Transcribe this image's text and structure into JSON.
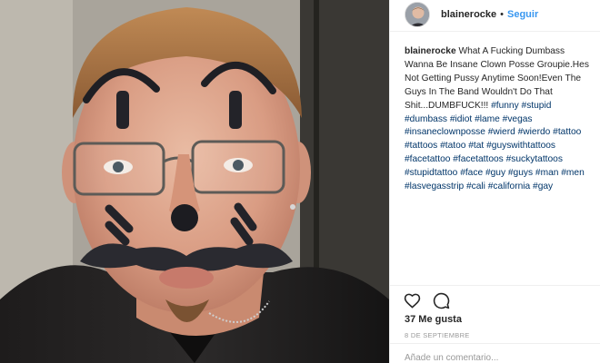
{
  "post": {
    "username": "blainerocke",
    "separator": "•",
    "follow_label": "Seguir",
    "caption_text": "What A Fucking Dumbass Wanna Be Insane Clown Posse Groupie.Hes Not Getting Pussy Anytime Soon!Even The Guys In The Band Wouldn't Do That Shit...DUMBFUCK!!!",
    "hashtags": [
      "#funny",
      "#stupid",
      "#dumbass",
      "#idiot",
      "#lame",
      "#vegas",
      "#insaneclownposse",
      "#wierd",
      "#wierdo",
      "#tattoo",
      "#tattoos",
      "#tatoo",
      "#tat",
      "#guyswithtattoos",
      "#facetattoo",
      "#facetattoos",
      "#suckytattoos",
      "#stupidtattoo",
      "#face",
      "#guy",
      "#guys",
      "#man",
      "#men",
      "#lasvegasstrip",
      "#cali",
      "#california",
      "#gay"
    ],
    "likes_text": "37 Me gusta",
    "date_text": "8 DE SEPTIEMBRE",
    "comment_placeholder": "Añade un comentario..."
  },
  "icons": {
    "like": "heart-outline-icon",
    "comment": "speech-bubble-icon",
    "avatar": "profile-photo"
  },
  "colors": {
    "link_blue": "#3897f0",
    "hashtag_blue": "#003569",
    "text": "#262626",
    "muted": "#999999",
    "border": "#efefef"
  }
}
